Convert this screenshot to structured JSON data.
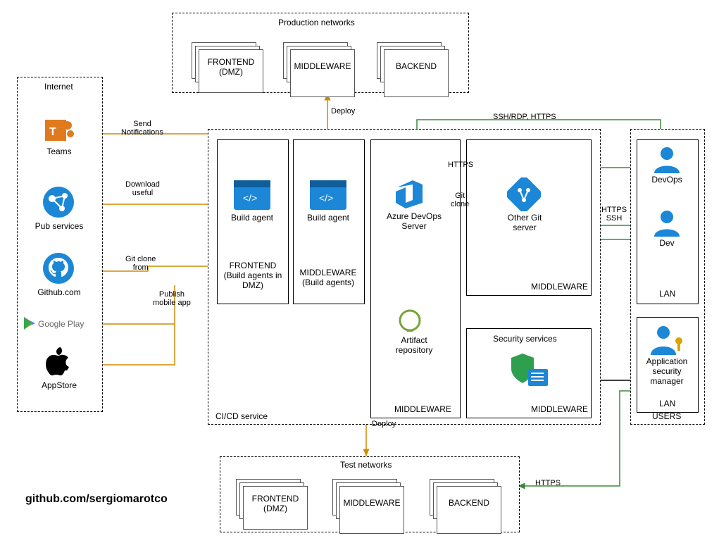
{
  "zones": {
    "internet": {
      "title": "Internet"
    },
    "production": {
      "title": "Production networks"
    },
    "cicd": {
      "title": "CI/CD service"
    },
    "test": {
      "title": "Test networks"
    },
    "users": {
      "title": "USERS"
    }
  },
  "prod_boxes": {
    "frontend": "FRONTEND\n(DMZ)",
    "middleware": "MIDDLEWARE",
    "backend": "BACKEND"
  },
  "test_boxes": {
    "frontend": "FRONTEND\n(DMZ)",
    "middleware": "MIDDLEWARE",
    "backend": "BACKEND"
  },
  "cicd_cols": {
    "a": {
      "label": "FRONTEND\n(Build agents in DMZ)",
      "node": "Build agent"
    },
    "b": {
      "label": "MIDDLEWARE\n(Build agents)",
      "node": "Build agent"
    },
    "c": {
      "label": "MIDDLEWARE",
      "nodes": {
        "azure": "Azure DevOps\nServer",
        "artifact": "Artifact\nrepository"
      }
    },
    "d": {
      "label_top": "MIDDLEWARE",
      "label_bot": "MIDDLEWARE",
      "nodes": {
        "git": "Other Git\nserver",
        "sec": "Security services"
      }
    }
  },
  "internet_nodes": {
    "teams": "Teams",
    "pub": "Pub services",
    "github": "Github.com",
    "gplay": "Google Play",
    "appstore": "AppStore"
  },
  "users_nodes": {
    "devops": "DevOps",
    "dev": "Dev",
    "lan1": "LAN",
    "secmgr": "Application\nsecurity\nmanager",
    "lan2": "LAN"
  },
  "edges": {
    "deploy_up": "Deploy",
    "deploy_down": "Deploy",
    "send": "Send\nNotifications",
    "download": "Download\nuseful",
    "gitclone": "Git clone\nfrom",
    "publish": "Publish\nmobile app",
    "ssh_rdp": "SSH/RDP, HTTPS",
    "https_top": "HTTPS",
    "gitclone2": "Git\nclone",
    "https_ssh": "HTTPS\nSSH",
    "https_test": "HTTPS"
  },
  "credit": "github.com/sergiomarotco"
}
